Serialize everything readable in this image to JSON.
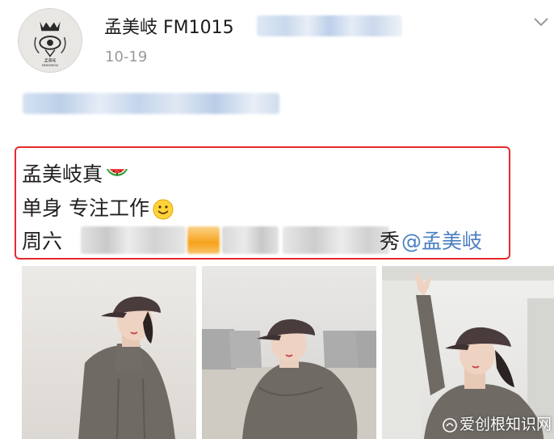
{
  "post": {
    "author": "孟美岐 FM1015",
    "date": "10-19",
    "avatar_text": "孟美岐",
    "avatar_subtext": "MENGMEIQI"
  },
  "content": {
    "line1": "孟美岐真",
    "line1_emoji": "watermelon-emoji",
    "line2": "单身 专注工作",
    "line2_emoji": "smiley-emoji",
    "line3_prefix": "周六",
    "line3_trail": "秀",
    "mention": "@孟美岐"
  },
  "photos": [
    {
      "name": "photo-1",
      "subject": "person-in-cap"
    },
    {
      "name": "photo-2",
      "subject": "person-crouching"
    },
    {
      "name": "photo-3",
      "subject": "person-arm-raised"
    }
  ],
  "watermark": {
    "text": "爱创根知识网"
  },
  "colors": {
    "highlight_border": "#e52b2b",
    "mention": "#4a7fc2",
    "date": "#9a9a9a"
  }
}
